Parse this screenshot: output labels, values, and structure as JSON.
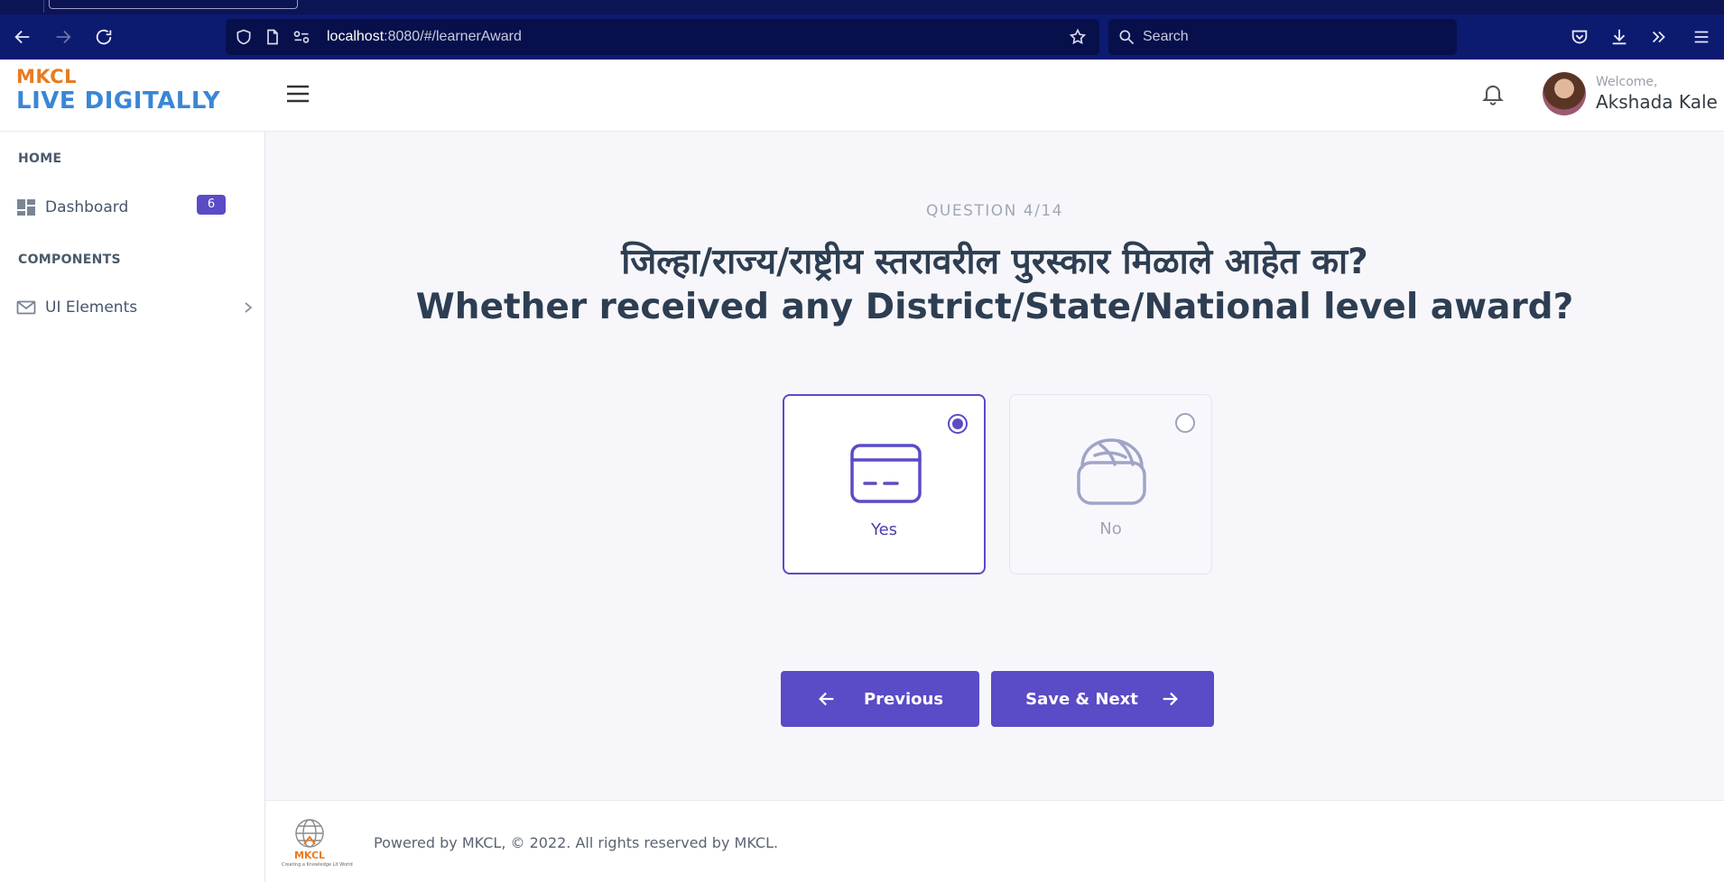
{
  "browser": {
    "url_host": "localhost",
    "url_path": ":8080/#/learnerAward",
    "search_placeholder": "Search"
  },
  "header": {
    "logo_line1": "MKCL",
    "logo_line2": "LIVE DIGITALLY",
    "welcome": "Welcome,",
    "user_name": "Akshada Kale"
  },
  "sidebar": {
    "section_home": "HOME",
    "section_components": "COMPONENTS",
    "items": [
      {
        "label": "Dashboard",
        "badge": "6",
        "icon": "dashboard-icon"
      },
      {
        "label": "UI Elements",
        "icon": "mail-icon"
      }
    ]
  },
  "question": {
    "number": "QUESTION 4/14",
    "text_marathi": "जिल्हा/राज्य/राष्ट्रीय स्तरावरील पुरस्कार मिळाले आहेत का?",
    "text_english": "Whether received any District/State/National level award?"
  },
  "options": [
    {
      "label": "Yes",
      "selected": true
    },
    {
      "label": "No",
      "selected": false
    }
  ],
  "buttons": {
    "previous": "Previous",
    "save_next": "Save & Next"
  },
  "footer": {
    "logo_name": "MKCL",
    "logo_tagline": "Creating a Knowledge Lit World",
    "text": "Powered by MKCL, © 2022. All rights reserved by MKCL."
  },
  "colors": {
    "accent": "#5a4bc6",
    "browser_bar": "#0c1a70",
    "logo_orange": "#e87b22",
    "logo_blue": "#3a86d6"
  }
}
